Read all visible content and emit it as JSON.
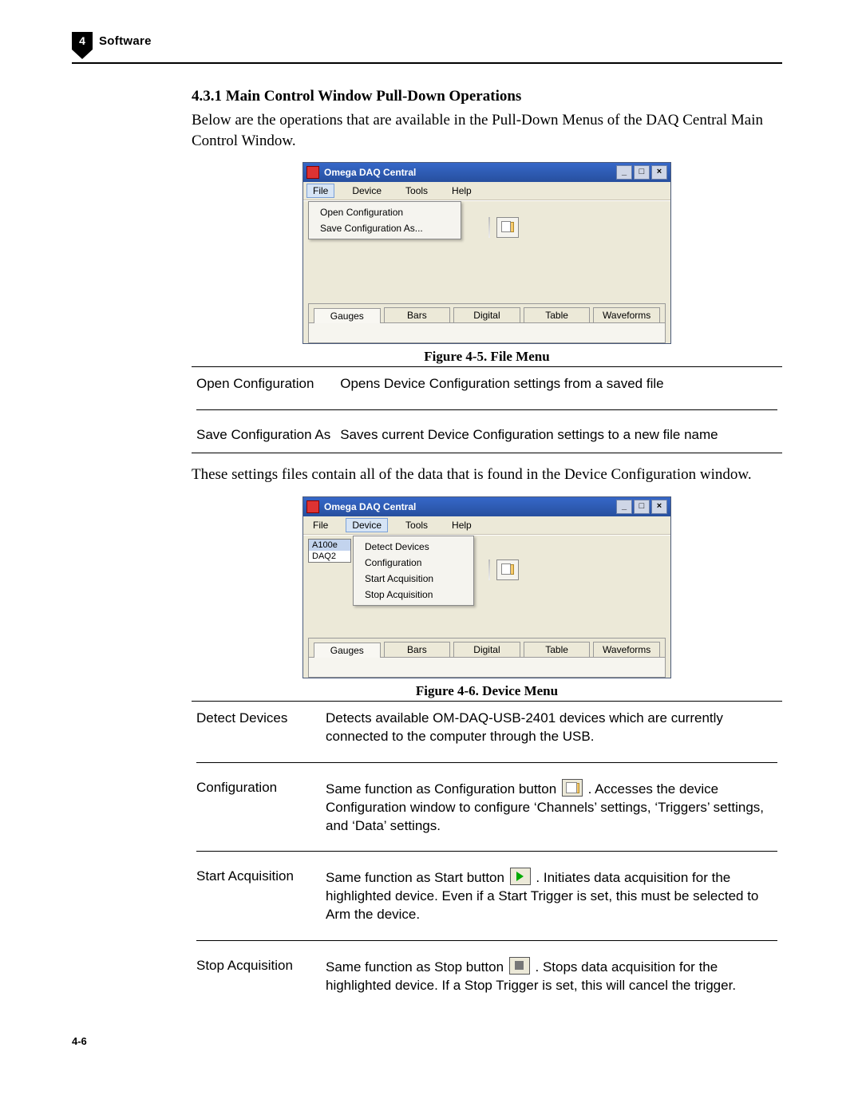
{
  "page_header": {
    "chapter_number": "4",
    "chapter_title": "Software"
  },
  "page_footer": "4-6",
  "section": {
    "heading": "4.3.1 Main Control Window Pull-Down Operations",
    "intro": "Below are the operations that are available in the Pull-Down Menus of the DAQ Central Main Control Window."
  },
  "figure1": {
    "caption": "Figure 4-5.  File Menu",
    "window": {
      "title": "Omega DAQ Central",
      "menus": [
        "File",
        "Device",
        "Tools",
        "Help"
      ],
      "open_menu_index": 0,
      "dropdown_items": [
        "Open Configuration",
        "Save Configuration As..."
      ],
      "tabs": [
        "Gauges",
        "Bars",
        "Digital",
        "Table",
        "Waveforms"
      ]
    }
  },
  "table1": {
    "rows": [
      {
        "term": "Open Configuration",
        "desc": "Opens Device Configuration settings from a saved file"
      },
      {
        "term": "Save Configuration As",
        "desc": "Saves current Device Configuration settings to a new file name"
      }
    ]
  },
  "mid_paragraph": "These settings files contain all of the data that is found in the Device Configuration window.",
  "figure2": {
    "caption": "Figure 4-6.  Device Menu",
    "window": {
      "title": "Omega DAQ Central",
      "menus": [
        "File",
        "Device",
        "Tools",
        "Help"
      ],
      "open_menu_index": 1,
      "device_list": [
        "A100e",
        "DAQ2"
      ],
      "dropdown_items": [
        "Detect Devices",
        "Configuration",
        "Start Acquisition",
        "Stop Acquisition"
      ],
      "tabs": [
        "Gauges",
        "Bars",
        "Digital",
        "Table",
        "Waveforms"
      ]
    }
  },
  "table2": {
    "rows": [
      {
        "term": "Detect Devices",
        "desc": "Detects available OM-DAQ-USB-2401 devices which are currently connected to the computer through the USB."
      },
      {
        "term": "Configuration",
        "desc_before": "Same function as Configuration button ",
        "icon": "cfg",
        "desc_after": ". Accesses the device Configuration window to configure ‘Channels’ settings, ‘Triggers’ settings, and ‘Data’ settings."
      },
      {
        "term": "Start Acquisition",
        "desc_before": "Same function as Start button ",
        "icon": "play",
        "desc_after": ". Initiates data acquisition for the highlighted device.  Even if a Start Trigger is set, this must be selected to Arm the device."
      },
      {
        "term": "Stop Acquisition",
        "desc_before": "Same function as Stop button ",
        "icon": "stop",
        "desc_after": ". Stops data acquisition for the highlighted device. If a Stop Trigger is set, this will cancel the trigger."
      }
    ]
  },
  "win_buttons": {
    "min": "_",
    "max": "□",
    "close": "×"
  }
}
